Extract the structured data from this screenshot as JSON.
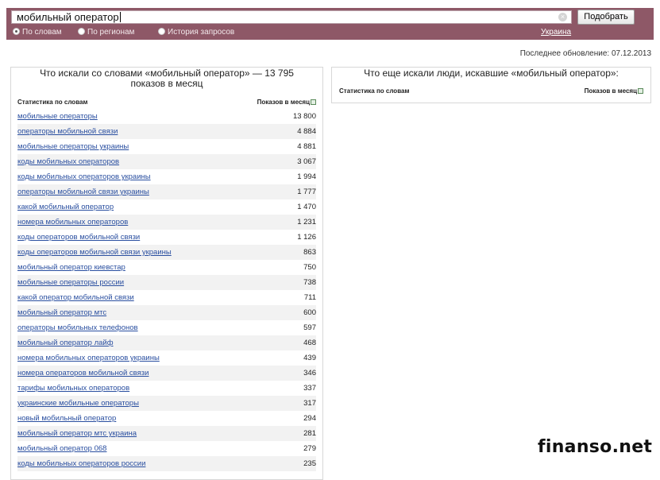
{
  "search": {
    "query": "мобильный оператор",
    "button_label": "Подобрать",
    "clear_icon": "close-icon"
  },
  "modes": [
    {
      "label": "По словам",
      "selected": true
    },
    {
      "label": "По регионам",
      "selected": false
    },
    {
      "label": "История запросов",
      "selected": false
    }
  ],
  "region": "Украина",
  "last_update": "Последнее обновление: 07.12.2013",
  "left_panel": {
    "title": "Что искали со словами «мобильный оператор» — 13 795 показов в месяц",
    "col_words": "Статистика по словам",
    "col_shows": "Показов в месяц",
    "rows": [
      {
        "q": "мобильные операторы",
        "n": "13 800"
      },
      {
        "q": "операторы мобильной связи",
        "n": "4 884"
      },
      {
        "q": "мобильные операторы украины",
        "n": "4 881"
      },
      {
        "q": "коды мобильных операторов",
        "n": "3 067"
      },
      {
        "q": "коды мобильных операторов украины",
        "n": "1 994"
      },
      {
        "q": "операторы мобильной связи украины",
        "n": "1 777"
      },
      {
        "q": "какой мобильный оператор",
        "n": "1 470"
      },
      {
        "q": "номера мобильных операторов",
        "n": "1 231"
      },
      {
        "q": "коды операторов мобильной связи",
        "n": "1 126"
      },
      {
        "q": "коды операторов мобильной связи украины",
        "n": "863"
      },
      {
        "q": "мобильный оператор киевстар",
        "n": "750"
      },
      {
        "q": "мобильные операторы россии",
        "n": "738"
      },
      {
        "q": "какой оператор мобильной связи",
        "n": "711"
      },
      {
        "q": "мобильный оператор мтс",
        "n": "600"
      },
      {
        "q": "операторы мобильных телефонов",
        "n": "597"
      },
      {
        "q": "мобильный оператор лайф",
        "n": "468"
      },
      {
        "q": "номера мобильных операторов украины",
        "n": "439"
      },
      {
        "q": "номера операторов мобильной связи",
        "n": "346"
      },
      {
        "q": "тарифы мобильных операторов",
        "n": "337"
      },
      {
        "q": "украинские мобильные операторы",
        "n": "317"
      },
      {
        "q": "новый мобильный оператор",
        "n": "294"
      },
      {
        "q": "мобильный оператор мтс украина",
        "n": "281"
      },
      {
        "q": "мобильный оператор 068",
        "n": "279"
      },
      {
        "q": "коды мобильных операторов россии",
        "n": "235"
      }
    ]
  },
  "right_panel": {
    "title": "Что еще искали люди, искавшие «мобильный оператор»:",
    "col_words": "Статистика по словам",
    "col_shows": "Показов в месяц"
  },
  "watermark": "finanso.net",
  "colors": {
    "band": "#8e5867",
    "link": "#2a4fa0"
  }
}
